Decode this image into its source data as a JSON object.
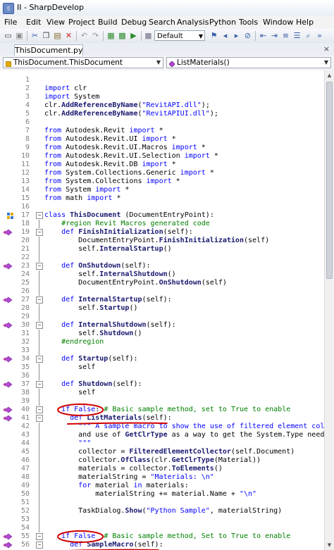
{
  "window": {
    "title": "II - SharpDevelop",
    "app_icon": "sharpdevelop-icon"
  },
  "menu": [
    "File",
    "Edit",
    "View",
    "Project",
    "Build",
    "Debug",
    "Search",
    "Analysis",
    "Python",
    "Tools",
    "Window",
    "Help"
  ],
  "toolbar": {
    "layout_label": "Default layout"
  },
  "tab": {
    "label": "ThisDocument.py",
    "close": "×"
  },
  "nav": {
    "class_combo": "ThisDocument.ThisDocument",
    "member_combo": "ListMaterials()"
  },
  "colors": {
    "keyword": "#0000ff",
    "comment": "#008000",
    "string": "#0000ff",
    "annotation": "#d00000"
  },
  "code": [
    {
      "n": "1",
      "t": ""
    },
    {
      "n": "2",
      "t": "import clr"
    },
    {
      "n": "3",
      "t": "import System"
    },
    {
      "n": "4",
      "t": "clr.AddReferenceByName(\"RevitAPI.dll\");"
    },
    {
      "n": "5",
      "t": "clr.AddReferenceByName(\"RevitAPIUI.dll\");"
    },
    {
      "n": "6",
      "t": ""
    },
    {
      "n": "7",
      "t": "from Autodesk.Revit import *"
    },
    {
      "n": "8",
      "t": "from Autodesk.Revit.UI import *"
    },
    {
      "n": "9",
      "t": "from Autodesk.Revit.UI.Macros import *"
    },
    {
      "n": "10",
      "t": "from Autodesk.Revit.UI.Selection import *"
    },
    {
      "n": "11",
      "t": "from Autodesk.Revit.DB import *"
    },
    {
      "n": "12",
      "t": "from System.Collections.Generic import *"
    },
    {
      "n": "13",
      "t": "from System.Collections import *"
    },
    {
      "n": "14",
      "t": "from System import *"
    },
    {
      "n": "15",
      "t": "from math import *"
    },
    {
      "n": "16",
      "t": ""
    },
    {
      "n": "17",
      "t": "class ThisDocument (DocumentEntryPoint):"
    },
    {
      "n": "18",
      "t": "    #region Revit Macros generated code"
    },
    {
      "n": "19",
      "t": "    def FinishInitialization(self):"
    },
    {
      "n": "20",
      "t": "        DocumentEntryPoint.FinishInitialization(self)"
    },
    {
      "n": "21",
      "t": "        self.InternalStartup()"
    },
    {
      "n": "22",
      "t": ""
    },
    {
      "n": "23",
      "t": "    def OnShutdown(self):"
    },
    {
      "n": "24",
      "t": "        self.InternalShutdown()"
    },
    {
      "n": "25",
      "t": "        DocumentEntryPoint.OnShutdown(self)"
    },
    {
      "n": "26",
      "t": ""
    },
    {
      "n": "27",
      "t": "    def InternalStartup(self):"
    },
    {
      "n": "28",
      "t": "        self.Startup()"
    },
    {
      "n": "29",
      "t": ""
    },
    {
      "n": "30",
      "t": "    def InternalShutdown(self):"
    },
    {
      "n": "31",
      "t": "        self.Shutdown()"
    },
    {
      "n": "32",
      "t": "    #endregion"
    },
    {
      "n": "33",
      "t": ""
    },
    {
      "n": "34",
      "t": "    def Startup(self):"
    },
    {
      "n": "35",
      "t": "        self"
    },
    {
      "n": "36",
      "t": ""
    },
    {
      "n": "37",
      "t": "    def Shutdown(self):"
    },
    {
      "n": "38",
      "t": "        self"
    },
    {
      "n": "39",
      "t": ""
    },
    {
      "n": "40",
      "t": "    if False: # Basic sample method, set to True to enable"
    },
    {
      "n": "41",
      "t": "      def ListMaterials(self):"
    },
    {
      "n": "42",
      "t": "        \"\"\" A sample macro to show the use of filtered element colle"
    },
    {
      "n": "43",
      "t": "        and use of GetClrType as a way to get the System.Type neede"
    },
    {
      "n": "44",
      "t": "        \"\"\""
    },
    {
      "n": "45",
      "t": "        collector = FilteredElementCollector(self.Document)"
    },
    {
      "n": "46",
      "t": "        collector.OfClass(clr.GetClrType(Material))"
    },
    {
      "n": "47",
      "t": "        materials = collector.ToElements()"
    },
    {
      "n": "48",
      "t": "        materialString = \"Materials: \\n\""
    },
    {
      "n": "49",
      "t": "        for material in materials:"
    },
    {
      "n": "50",
      "t": "            materialString += material.Name + \"\\n\""
    },
    {
      "n": "51",
      "t": ""
    },
    {
      "n": "52",
      "t": "        TaskDialog.Show(\"Python Sample\", materialString)"
    },
    {
      "n": "53",
      "t": ""
    },
    {
      "n": "54",
      "t": ""
    },
    {
      "n": "55",
      "t": "    if False  # Basic sample method, Set to True to enable"
    },
    {
      "n": "56",
      "t": "      def SampleMacro(self):"
    }
  ]
}
